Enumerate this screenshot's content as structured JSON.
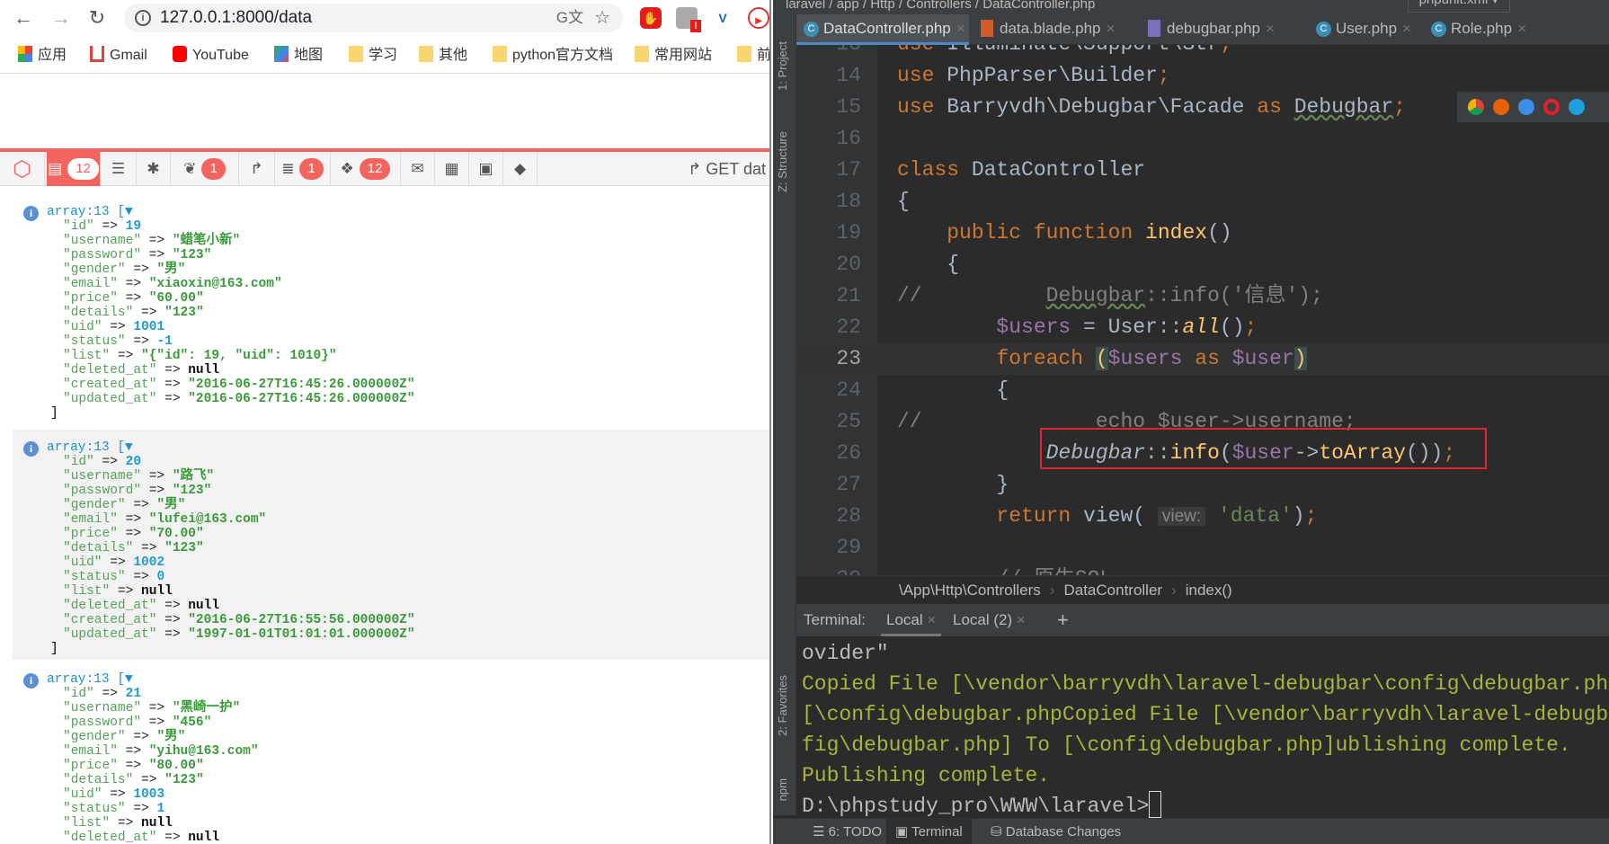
{
  "browser": {
    "url": "127.0.0.1:8000/data",
    "bookmarks": [
      {
        "label": "应用",
        "icon": "apps-grid-icon"
      },
      {
        "label": "Gmail",
        "icon": "gmail-icon"
      },
      {
        "label": "YouTube",
        "icon": "youtube-icon"
      },
      {
        "label": "地图",
        "icon": "maps-icon"
      },
      {
        "label": "学习",
        "icon": "folder-icon"
      },
      {
        "label": "其他",
        "icon": "folder-icon"
      },
      {
        "label": "python官方文档",
        "icon": "folder-icon"
      },
      {
        "label": "常用网站",
        "icon": "folder-icon"
      },
      {
        "label": "前",
        "icon": "folder-icon"
      }
    ],
    "ext_badge": "!"
  },
  "debugbar": {
    "accent": "#f4645f",
    "tabs": [
      {
        "icon": "messages-icon",
        "badge": "12",
        "active": true
      },
      {
        "icon": "timeline-icon"
      },
      {
        "icon": "exceptions-icon"
      },
      {
        "icon": "views-icon",
        "badge": "1"
      },
      {
        "icon": "route-icon"
      },
      {
        "icon": "queries-icon",
        "badge": "1"
      },
      {
        "icon": "models-icon",
        "badge": "12"
      },
      {
        "icon": "mails-icon"
      },
      {
        "icon": "request-icon"
      },
      {
        "icon": "session-icon"
      },
      {
        "icon": "tags-icon"
      }
    ],
    "request": "GET dat",
    "dumps": [
      {
        "header": "array:13 [▼",
        "rows": [
          [
            "\"id\"",
            "19",
            "n"
          ],
          [
            "\"username\"",
            "\"蜡笔小新\"",
            "s"
          ],
          [
            "\"password\"",
            "\"123\"",
            "s"
          ],
          [
            "\"gender\"",
            "\"男\"",
            "s"
          ],
          [
            "\"email\"",
            "\"xiaoxin@163.com\"",
            "s"
          ],
          [
            "\"price\"",
            "\"60.00\"",
            "s"
          ],
          [
            "\"details\"",
            "\"123\"",
            "s"
          ],
          [
            "\"uid\"",
            "1001",
            "n"
          ],
          [
            "\"status\"",
            "-1",
            "n"
          ],
          [
            "\"list\"",
            "\"{\"id\": 19, \"uid\": 1010}\"",
            "s"
          ],
          [
            "\"deleted_at\"",
            "null",
            "nl"
          ],
          [
            "\"created_at\"",
            "\"2016-06-27T16:45:26.000000Z\"",
            "s"
          ],
          [
            "\"updated_at\"",
            "\"2016-06-27T16:45:26.000000Z\"",
            "s"
          ]
        ],
        "close": "]"
      },
      {
        "header": "array:13 [▼",
        "rows": [
          [
            "\"id\"",
            "20",
            "n"
          ],
          [
            "\"username\"",
            "\"路飞\"",
            "s"
          ],
          [
            "\"password\"",
            "\"123\"",
            "s"
          ],
          [
            "\"gender\"",
            "\"男\"",
            "s"
          ],
          [
            "\"email\"",
            "\"lufei@163.com\"",
            "s"
          ],
          [
            "\"price\"",
            "\"70.00\"",
            "s"
          ],
          [
            "\"details\"",
            "\"123\"",
            "s"
          ],
          [
            "\"uid\"",
            "1002",
            "n"
          ],
          [
            "\"status\"",
            "0",
            "n"
          ],
          [
            "\"list\"",
            "null",
            "nl"
          ],
          [
            "\"deleted_at\"",
            "null",
            "nl"
          ],
          [
            "\"created_at\"",
            "\"2016-06-27T16:55:56.000000Z\"",
            "s"
          ],
          [
            "\"updated_at\"",
            "\"1997-01-01T01:01:01.000000Z\"",
            "s"
          ]
        ],
        "close": "]"
      },
      {
        "header": "array:13 [▼",
        "rows": [
          [
            "\"id\"",
            "21",
            "n"
          ],
          [
            "\"username\"",
            "\"黑崎一护\"",
            "s"
          ],
          [
            "\"password\"",
            "\"456\"",
            "s"
          ],
          [
            "\"gender\"",
            "\"男\"",
            "s"
          ],
          [
            "\"email\"",
            "\"yihu@163.com\"",
            "s"
          ],
          [
            "\"price\"",
            "\"80.00\"",
            "s"
          ],
          [
            "\"details\"",
            "\"123\"",
            "s"
          ],
          [
            "\"uid\"",
            "1003",
            "n"
          ],
          [
            "\"status\"",
            "1",
            "n"
          ],
          [
            "\"list\"",
            "null",
            "nl"
          ],
          [
            "\"deleted_at\"",
            "null",
            "nl"
          ]
        ],
        "close": ""
      }
    ],
    "arrow": "=>"
  },
  "ide": {
    "path": "laravel / app / Http / Controllers / DataController.php",
    "run_config": "phpunit.xml",
    "tabs": [
      {
        "label": "DataController.php",
        "icon": "php-class-icon",
        "active": true
      },
      {
        "label": "data.blade.php",
        "icon": "blade-file-icon"
      },
      {
        "label": "debugbar.php",
        "icon": "php-file-icon"
      },
      {
        "label": "User.php",
        "icon": "php-class-icon"
      },
      {
        "label": "Role.php",
        "icon": "php-class-icon"
      }
    ],
    "side_labels": [
      "1: Project",
      "Z: Structure",
      "2: Favorites",
      "npm"
    ],
    "current_line": "23",
    "lines": [
      {
        "n": "13",
        "seg": [
          [
            "kw",
            "use "
          ],
          [
            "",
            "Illuminate\\Support\\Str"
          ],
          [
            "pn",
            ";"
          ]
        ]
      },
      {
        "n": "14",
        "seg": [
          [
            "kw",
            "use "
          ],
          [
            "",
            "PhpParser\\Builder"
          ],
          [
            "pn",
            ";"
          ]
        ]
      },
      {
        "n": "15",
        "seg": [
          [
            "kw",
            "use "
          ],
          [
            "",
            "Barryvdh\\Debugbar\\Facade "
          ],
          [
            "kw",
            "as "
          ],
          [
            "und",
            "Debugbar"
          ],
          [
            "pn",
            ";"
          ]
        ]
      },
      {
        "n": "16",
        "seg": []
      },
      {
        "n": "17",
        "seg": [
          [
            "kw",
            "class "
          ],
          [
            "",
            "DataController"
          ]
        ]
      },
      {
        "n": "18",
        "seg": [
          [
            "",
            "{"
          ]
        ]
      },
      {
        "n": "19",
        "seg": [
          [
            "kw",
            "    public function "
          ],
          [
            "fn",
            "index"
          ],
          [
            "",
            "()"
          ]
        ]
      },
      {
        "n": "20",
        "seg": [
          [
            "",
            "    {"
          ]
        ]
      },
      {
        "n": "21",
        "seg": [
          [
            "cm",
            "//          "
          ],
          [
            "cm und",
            "Debugbar"
          ],
          [
            "cm",
            "::info('信息');"
          ]
        ]
      },
      {
        "n": "22",
        "seg": [
          [
            "v",
            "        $users"
          ],
          [
            "",
            " = User::"
          ],
          [
            "fn it",
            "all"
          ],
          [
            "",
            "()"
          ],
          [
            "pn",
            ";"
          ]
        ]
      },
      {
        "n": "23",
        "seg": [
          [
            "kw",
            "        foreach "
          ],
          [
            "fn hl",
            "("
          ],
          [
            "v",
            "$users "
          ],
          [
            "kw",
            "as "
          ],
          [
            "v",
            "$user"
          ],
          [
            "fn hl",
            ")"
          ]
        ]
      },
      {
        "n": "24",
        "seg": [
          [
            "",
            "        {"
          ]
        ]
      },
      {
        "n": "25",
        "seg": [
          [
            "cm",
            "//              echo $user->username;"
          ]
        ]
      },
      {
        "n": "26",
        "seg": [
          [
            "it",
            "            Debugbar"
          ],
          [
            "",
            "::"
          ],
          [
            "fn",
            "info"
          ],
          [
            "",
            "("
          ],
          [
            "v",
            "$user"
          ],
          [
            "",
            "->"
          ],
          [
            "fn",
            "toArray"
          ],
          [
            "",
            "())"
          ],
          [
            "pn",
            ";"
          ]
        ]
      },
      {
        "n": "27",
        "seg": [
          [
            "",
            "        }"
          ]
        ]
      },
      {
        "n": "28",
        "seg": [
          [
            "kw",
            "        return "
          ],
          [
            "",
            "view( "
          ],
          [
            "hint",
            "view:"
          ],
          [
            "str",
            " 'data'"
          ],
          [
            "",
            ")"
          ],
          [
            "pn",
            ";"
          ]
        ]
      },
      {
        "n": "29",
        "seg": []
      },
      {
        "n": "30",
        "seg": [
          [
            "cm",
            "        // 原生SQL"
          ]
        ]
      }
    ],
    "breadcrumb": [
      "\\App\\Http\\Controllers",
      "DataController",
      "index()"
    ],
    "terminal": {
      "label": "Terminal:",
      "tabs": [
        "Local",
        "Local (2)"
      ],
      "add": "+",
      "lines": [
        {
          "text": "ovider\"",
          "color": "#bbbbbb"
        },
        {
          "text": "Copied File [\\vendor\\barryvdh\\laravel-debugbar\\config\\debugbar.php",
          "color": "#a8b53a"
        },
        {
          "text": "[\\config\\debugbar.phpCopied File [\\vendor\\barryvdh\\laravel-debugba",
          "color": "#a8b53a"
        },
        {
          "text": "fig\\debugbar.php] To [\\config\\debugbar.php]ublishing complete.",
          "color": "#a8b53a"
        },
        {
          "text": "Publishing complete.",
          "color": "#a8b53a"
        },
        {
          "text": "D:\\phpstudy_pro\\WWW\\laravel>",
          "color": "#bbbbbb"
        }
      ]
    },
    "status_tabs": [
      {
        "label": "6: TODO",
        "icon": "todo-icon"
      },
      {
        "label": "Terminal",
        "icon": "terminal-icon",
        "active": true
      },
      {
        "label": "Database Changes",
        "icon": "database-icon"
      }
    ]
  }
}
